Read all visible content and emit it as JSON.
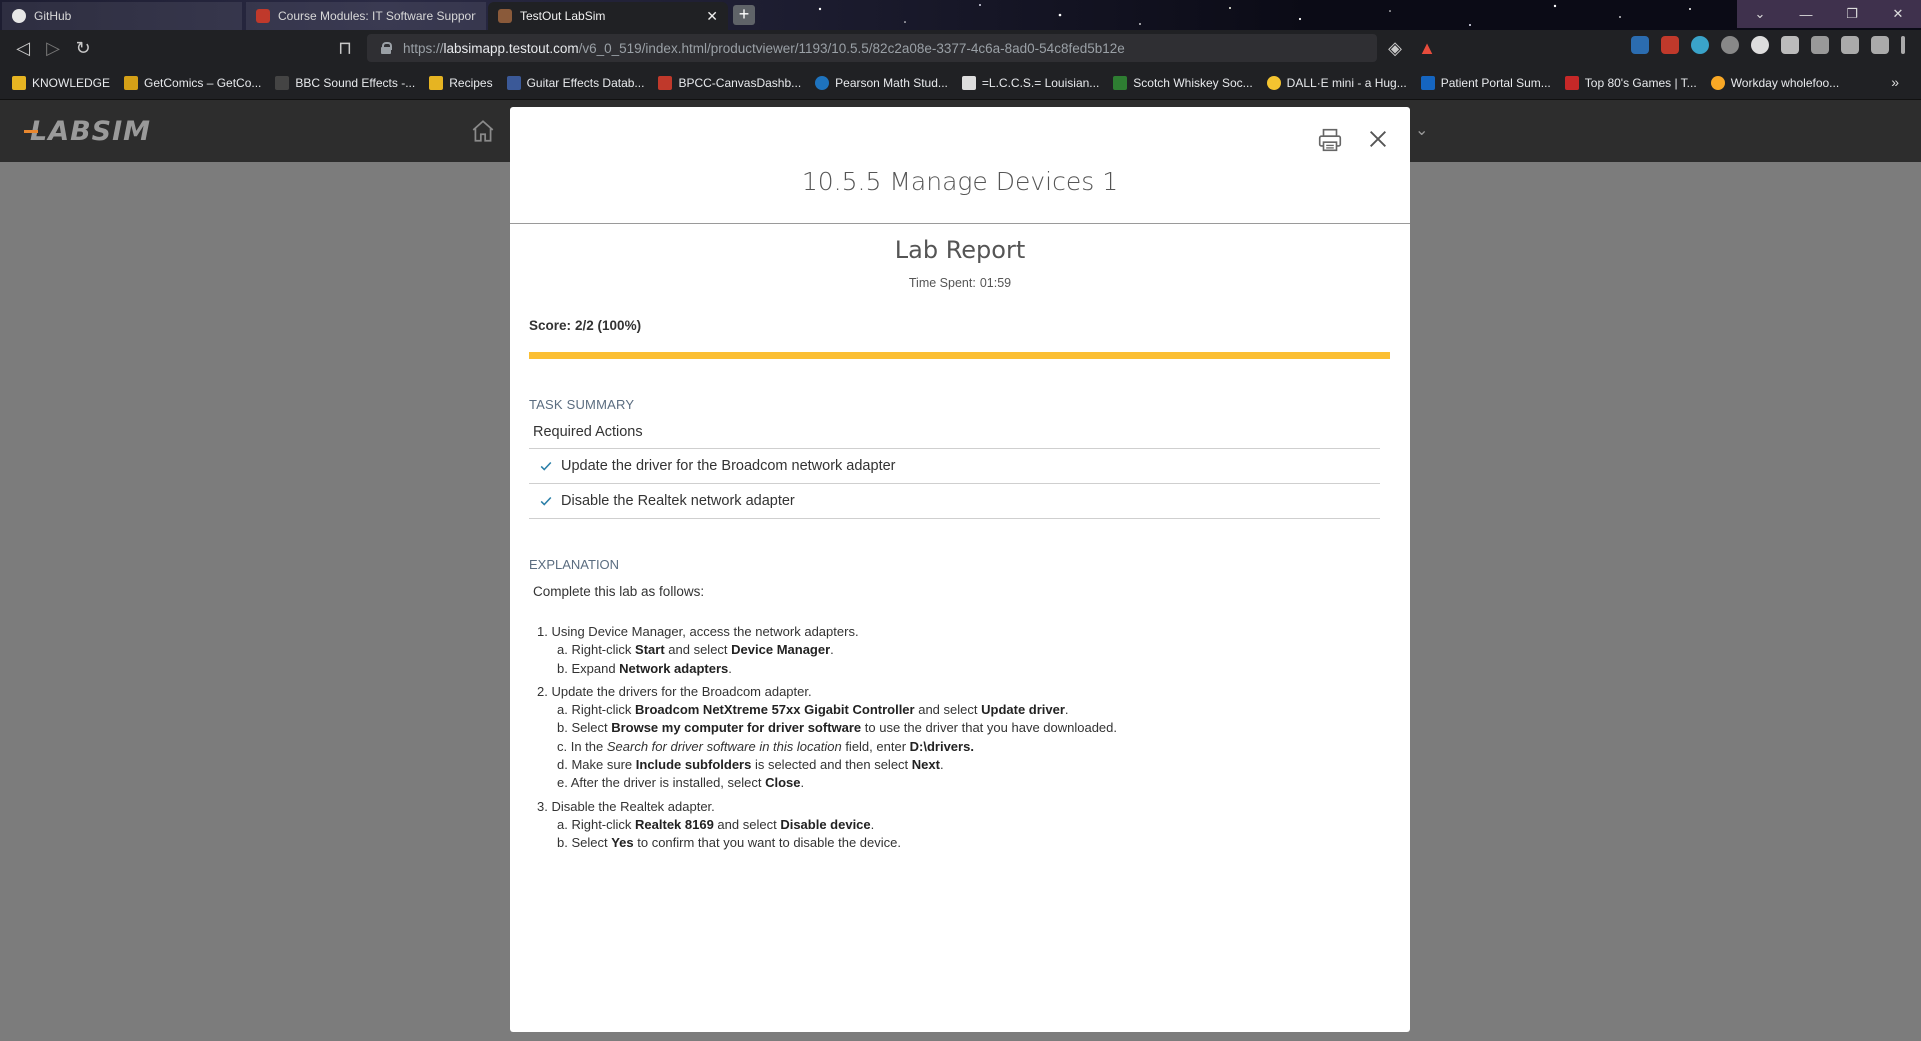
{
  "browser": {
    "tabs": [
      {
        "title": "GitHub",
        "active": false
      },
      {
        "title": "Course Modules: IT Software Support",
        "active": false
      },
      {
        "title": "TestOut LabSim",
        "active": true
      }
    ],
    "url_prefix": "https://",
    "url_host": "labsimapp.testout.com",
    "url_path": "/v6_0_519/index.html/productviewer/1193/10.5.5/82c2a08e-3377-4c6a-8ad0-54c8fed5b12e",
    "bookmarks": [
      "KNOWLEDGE",
      "GetComics – GetCo...",
      "BBC Sound Effects -...",
      "Recipes",
      "Guitar Effects Datab...",
      "BPCC-CanvasDashb...",
      "Pearson Math Stud...",
      "=L.C.C.S.= Louisian...",
      "Scotch Whiskey Soc...",
      "DALL·E mini - a Hug...",
      "Patient Portal Sum...",
      "Top 80's Games | T...",
      "Workday wholefoo..."
    ],
    "bookmarks_more": "»"
  },
  "app": {
    "logo": "LABSIM"
  },
  "modal": {
    "title": "10.5.5 Manage Devices 1",
    "report_title": "Lab Report",
    "time_label": "Time Spent:",
    "time_value": "01:59",
    "score_label": "Score:",
    "score_value": "2/2 (100%)",
    "score_fraction": 1.0,
    "task_summary_label": "TASK SUMMARY",
    "required_actions_label": "Required Actions",
    "actions": [
      "Update the driver for the Broadcom network adapter",
      "Disable the Realtek network adapter"
    ],
    "explanation_label": "EXPLANATION",
    "explanation_intro": "Complete this lab as follows:",
    "steps": {
      "s1": {
        "title": "1. Using Device Manager, access the network adapters.",
        "a": {
          "pre": "a. Right-click ",
          "b1": "Start",
          "mid": " and select ",
          "b2": "Device Manager",
          "post": "."
        },
        "b": {
          "pre": "b. Expand ",
          "b1": "Network adapters",
          "post": "."
        }
      },
      "s2": {
        "title": "2. Update the drivers for the Broadcom adapter.",
        "a": {
          "pre": "a. Right-click ",
          "b1": "Broadcom NetXtreme 57xx Gigabit Controller",
          "mid": " and select ",
          "b2": "Update driver",
          "post": "."
        },
        "b": {
          "pre": "b. Select ",
          "b1": "Browse my computer for driver software",
          "post": " to use the driver that you have downloaded."
        },
        "c": {
          "pre": "c. In the ",
          "i1": "Search for driver software in this location",
          "mid": " field, enter ",
          "b1": "D:\\drivers.",
          "post": ""
        },
        "d": {
          "pre": "d. Make sure ",
          "b1": "Include subfolders",
          "mid": " is selected and then select ",
          "b2": "Next",
          "post": "."
        },
        "e": {
          "pre": "e. After the driver is installed, select ",
          "b1": "Close",
          "post": "."
        }
      },
      "s3": {
        "title": "3. Disable the Realtek adapter.",
        "a": {
          "pre": "a. Right-click ",
          "b1": "Realtek 8169",
          "mid": " and select ",
          "b2": "Disable device",
          "post": "."
        },
        "b": {
          "pre": "b. Select ",
          "b1": "Yes",
          "post": " to confirm that you want to disable the device."
        }
      }
    }
  },
  "colors": {
    "progress": "#fbbf33",
    "check": "#2a7fa8",
    "label": "#5b6d80"
  }
}
